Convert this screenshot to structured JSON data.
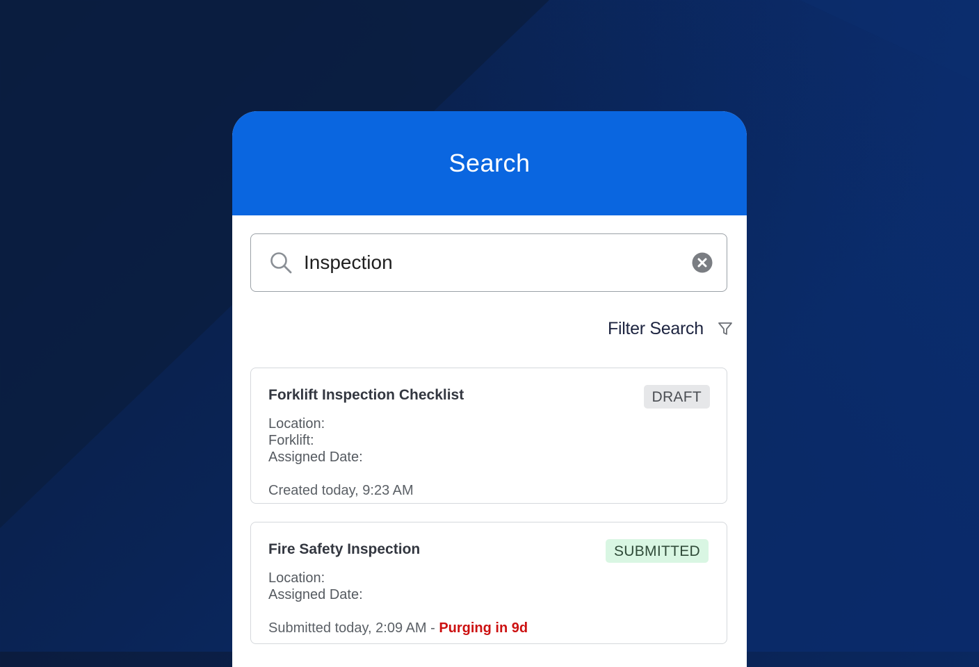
{
  "header": {
    "title": "Search"
  },
  "search": {
    "value": "Inspection",
    "placeholder": ""
  },
  "filter": {
    "label": "Filter Search"
  },
  "results": [
    {
      "title": "Forklift Inspection Checklist",
      "status": "DRAFT",
      "fields": [
        "Location:",
        "Forklift:",
        "Assigned Date:"
      ],
      "meta": "Created today, 9:23 AM"
    },
    {
      "title": "Fire Safety Inspection",
      "status": "SUBMITTED",
      "fields": [
        "Location:",
        "Assigned Date:"
      ],
      "meta": "Submitted today, 2:09 AM - ",
      "meta_alert": "Purging in 9d"
    }
  ],
  "colors": {
    "header": "#0a66e0",
    "draft_badge": "#e6e7e9",
    "submitted_badge": "#d9f6e3",
    "alert": "#cc1111"
  },
  "icons": [
    "search-icon",
    "clear-icon",
    "filter-icon"
  ]
}
